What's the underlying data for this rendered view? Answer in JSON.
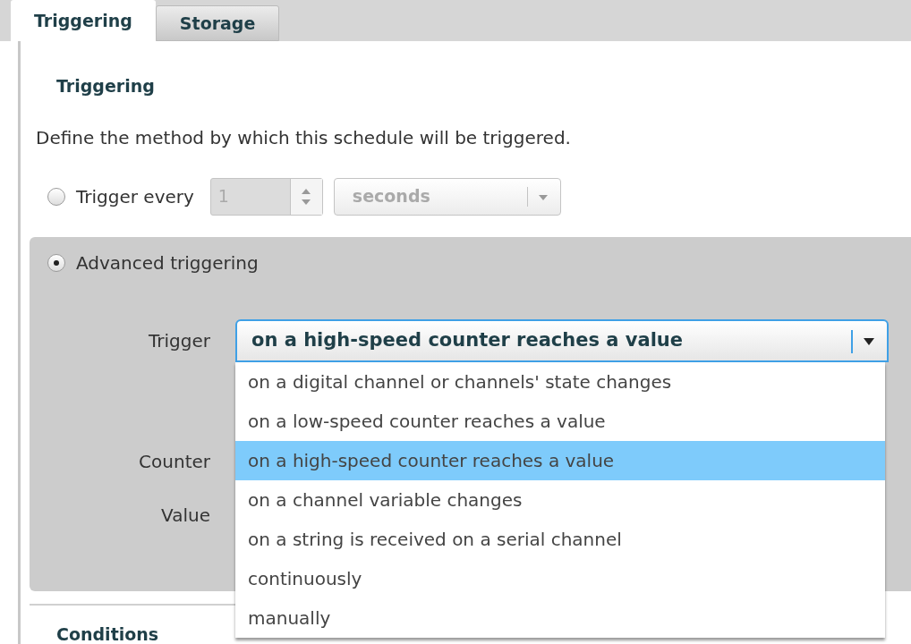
{
  "tabs": [
    {
      "label": "Triggering",
      "selected": true
    },
    {
      "label": "Storage",
      "selected": false
    }
  ],
  "section_title": "Triggering",
  "description": "Define the method by which this schedule will be triggered.",
  "trigger_every": {
    "label": "Trigger every",
    "selected": false,
    "value": "1",
    "unit": "seconds",
    "disabled": true
  },
  "advanced": {
    "label": "Advanced triggering",
    "selected": true,
    "trigger_label": "Trigger",
    "trigger_value": "on a high-speed counter reaches a value",
    "expanded": true,
    "options": [
      {
        "label": "on a digital channel or channels' state changes",
        "selected": false
      },
      {
        "label": "on a low-speed counter reaches a value",
        "selected": false
      },
      {
        "label": "on a high-speed counter reaches a value",
        "selected": true
      },
      {
        "label": "on a channel variable changes",
        "selected": false
      },
      {
        "label": "on a string is received on a serial channel",
        "selected": false
      },
      {
        "label": "continuously",
        "selected": false
      },
      {
        "label": "manually",
        "selected": false
      }
    ],
    "fields": [
      {
        "label": "Counter"
      },
      {
        "label": "Value"
      }
    ]
  },
  "next_section_title": "Conditions"
}
